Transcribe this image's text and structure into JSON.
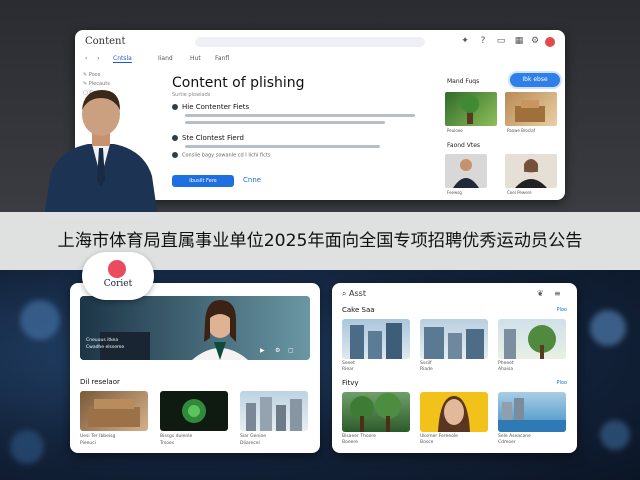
{
  "banner": {
    "text": "上海市体育局直属事业单位2025年面向全国专项招聘优秀运动员公告"
  },
  "top_window": {
    "title": "Content",
    "tabs": [
      "Cntsla",
      "Iiand",
      "Hut",
      "Fanfl"
    ],
    "sidebar": [
      "Poos",
      "Plecauts",
      "Conta's"
    ],
    "heading": "Content of plishing",
    "subheading": "Surtie plowiads",
    "section1": "Hie Contenter Fiets",
    "section2": "Ste Clontest Fierd",
    "section3": "Conslie bagy sowanle cd I lichi ficts",
    "primary_button": "Ibusilt Fere",
    "secondary_button": "Cnne",
    "right_heading1": "Mand Fuqs",
    "right_heading2": "Faond Vtes",
    "pill": "Ibk ebse",
    "thumb_captions": [
      "Peuloee",
      "Paowe Broclaf",
      "Feewsg",
      "Coel Pewere"
    ]
  },
  "bubble": {
    "label": "Coriet"
  },
  "left_panel": {
    "hero_caption1": "Cneuuus itkea",
    "hero_caption2": "Cwadhe elsseme",
    "section_title": "Dil reselaor",
    "captions": [
      "Uesi Ter Ibbeisg",
      "Bissgs dulenle",
      "Siar Genioe"
    ],
    "captions2": [
      "Pieeuci",
      "Trsoes",
      "Dliarecel"
    ]
  },
  "right_panel": {
    "search_label": "Asst",
    "section1_title": "Cake Saa",
    "section1_link": "Ploo",
    "section2_title": "Fitvy",
    "section2_link": "Ploo",
    "captions1": [
      "Seeet",
      "Sssilf",
      "Pheeet"
    ],
    "captions1b": [
      "Riear",
      "Riade",
      "Ahaisa"
    ],
    "captions2": [
      "Bisaeer Thoore",
      "Uksmer Fereeole",
      "Sele Aseacane"
    ],
    "captions2b": [
      "Boeere",
      "Bosce",
      "Cdmoer"
    ]
  }
}
